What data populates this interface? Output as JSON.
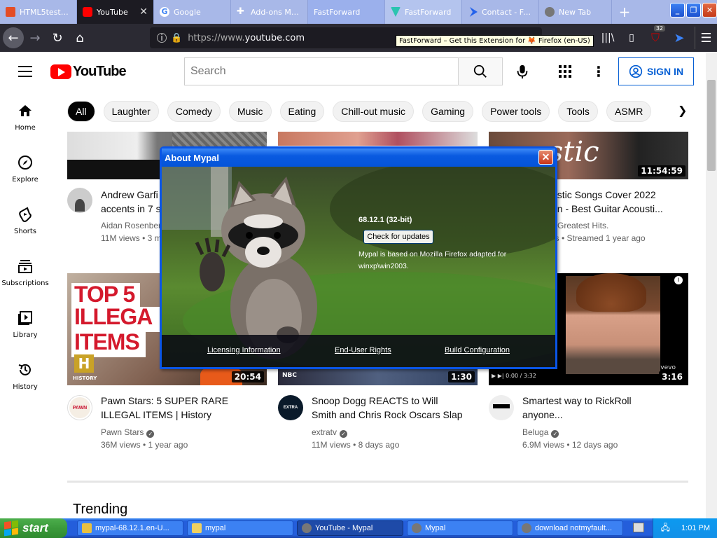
{
  "browser": {
    "tabs": [
      {
        "label": "HTML5test - H",
        "icon": "html5-icon",
        "color": "#e44d26"
      },
      {
        "label": "YouTube",
        "icon": "youtube-icon",
        "color": "#ff0000"
      },
      {
        "label": "Google",
        "icon": "google-icon",
        "color": "#4285f4"
      },
      {
        "label": "Add-ons Mana",
        "icon": "puzzle-icon",
        "color": "#ffffff"
      },
      {
        "label": "FastForward",
        "icon": "fastforward-icon",
        "color": "#00c4a0"
      },
      {
        "label": "FastForward",
        "icon": "fastforward-icon",
        "color": "#00c4a0"
      },
      {
        "label": "Contact - Fast",
        "icon": "fastforward-icon",
        "color": "#2563eb"
      },
      {
        "label": "New Tab",
        "icon": "raccoon-icon",
        "color": "#777777"
      }
    ],
    "url_prefix": "https://www.",
    "url_domain": "youtube.com",
    "tooltip": "FastForward – Get this Extension for 🦊 Firefox (en-US)",
    "badge_count": "32"
  },
  "youtube": {
    "logo_text": "YouTube",
    "search_placeholder": "Search",
    "sign_in": "SIGN IN",
    "chips": [
      "All",
      "Laughter",
      "Comedy",
      "Music",
      "Eating",
      "Chill-out music",
      "Gaming",
      "Power tools",
      "Tools",
      "ASMR"
    ],
    "nav": [
      {
        "label": "Home"
      },
      {
        "label": "Explore"
      },
      {
        "label": "Shorts"
      },
      {
        "label": "Subscriptions"
      },
      {
        "label": "Library"
      },
      {
        "label": "History"
      }
    ],
    "row1": [
      {
        "title1": "Andrew Garfi",
        "title2": "accents in 7 s",
        "channel": "Aidan Rosenber",
        "meta": "11M views • 3 m"
      },
      {
        "title1": "",
        "title2": "",
        "channel": "",
        "meta": ""
      },
      {
        "title1": "ustic Songs Cover 2022",
        "title2": "on - Best Guitar Acousti...",
        "channel": "Greatest Hits.",
        "meta": "ws • Streamed 1 year ago",
        "duration": "11:54:59",
        "thumb_text": "ustic"
      }
    ],
    "row2": [
      {
        "title1": "Pawn Stars: 5 SUPER RARE",
        "title2": "ILLEGAL ITEMS | History",
        "channel": "Pawn Stars",
        "meta": "36M views • 1 year ago",
        "duration": "20:54",
        "thumb_text1": "TOP 5",
        "thumb_text2": "ILLEGA",
        "thumb_text3": "ITEMS",
        "thumb_brand": "HISTORY",
        "avatar_text": "PAWN"
      },
      {
        "title1": "Snoop Dogg REACTS to Will",
        "title2": "Smith and Chris Rock Oscars Slap",
        "channel": "extratv",
        "meta": "11M views • 8 days ago",
        "duration": "1:30",
        "thumb_brand": "NBC",
        "avatar_text": "EXTRA"
      },
      {
        "title1": "Smartest way to RickRoll",
        "title2": "anyone...",
        "channel": "Beluga",
        "meta": "6.9M views • 12 days ago",
        "duration": "3:16",
        "thumb_brand": "vevo"
      }
    ],
    "section_title": "Trending"
  },
  "dialog": {
    "title": "About Mypal",
    "version": "68.12.1 (32-bit)",
    "update_button": "Check for updates",
    "info_line1": "Mypal is based on Mozilla Firefox adapted for",
    "info_line2": "winxp\\win2003.",
    "links": [
      "Licensing Information",
      "End-User Rights",
      "Build Configuration"
    ]
  },
  "taskbar": {
    "start": "start",
    "items": [
      {
        "label": "mypal-68.12.1.en-U...",
        "icon": "package-icon"
      },
      {
        "label": "mypal",
        "icon": "folder-icon"
      },
      {
        "label": "YouTube - Mypal",
        "icon": "raccoon-icon"
      },
      {
        "label": "Mypal",
        "icon": "raccoon-icon"
      },
      {
        "label": "download notmyfault...",
        "icon": "raccoon-icon"
      }
    ],
    "clock": "1:01 PM"
  }
}
